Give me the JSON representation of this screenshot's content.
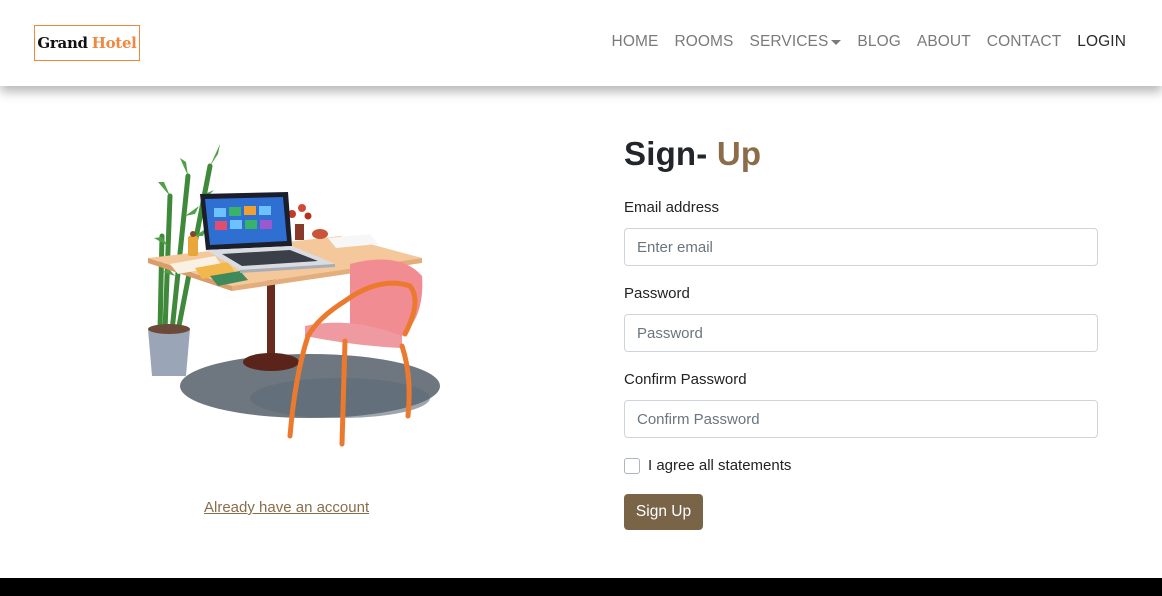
{
  "brand": {
    "part1": "Grand",
    "part2": "Hotel",
    "accent_color": "#f0893f"
  },
  "nav": {
    "items": [
      {
        "label": "HOME"
      },
      {
        "label": "ROOMS"
      },
      {
        "label": "SERVICES",
        "has_dropdown": true
      },
      {
        "label": "BLOG"
      },
      {
        "label": "ABOUT"
      },
      {
        "label": "CONTACT"
      },
      {
        "label": "LOGIN",
        "active": true
      }
    ]
  },
  "form": {
    "title_part1": "Sign-",
    "title_part2": "Up",
    "email_label": "Email address",
    "email_placeholder": "Enter email",
    "password_label": "Password",
    "password_placeholder": "Password",
    "confirm_label": "Confirm Password",
    "confirm_placeholder": "Confirm Password",
    "agree_label": "I agree all statements",
    "agree_checked": false,
    "submit_label": "Sign Up",
    "submit_color": "#7a6447"
  },
  "left": {
    "illustration_icon": "desk-workspace-illustration",
    "login_link": "Already have an account"
  }
}
